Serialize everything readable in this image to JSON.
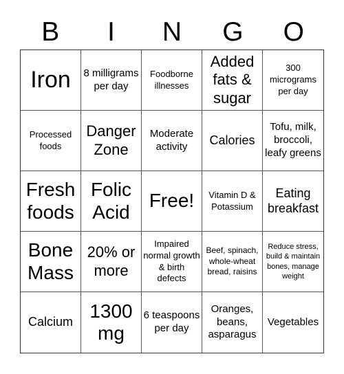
{
  "header": {
    "letters": [
      "B",
      "I",
      "N",
      "G",
      "O"
    ]
  },
  "cells": [
    [
      "Iron",
      "8 milligrams per day",
      "Foodborne illnesses",
      "Added fats & sugar",
      "300 micrograms per day"
    ],
    [
      "Processed foods",
      "Danger Zone",
      "Moderate activity",
      "Calories",
      "Tofu, milk, broccoli, leafy greens"
    ],
    [
      "Fresh foods",
      "Folic Acid",
      "Free!",
      "Vitamin D & Potassium",
      "Eating breakfast"
    ],
    [
      "Bone Mass",
      "20% or more",
      "Impaired normal growth & birth defects",
      "Beef, spinach, whole-wheat bread, raisins",
      "Reduce stress, build & maintain bones, manage weight"
    ],
    [
      "Calcium",
      "1300 mg",
      "6 teaspoons per day",
      "Oranges, beans, asparagus",
      "Vegetables"
    ]
  ],
  "free_space": {
    "row": 2,
    "col": 2,
    "label": "Free!"
  }
}
